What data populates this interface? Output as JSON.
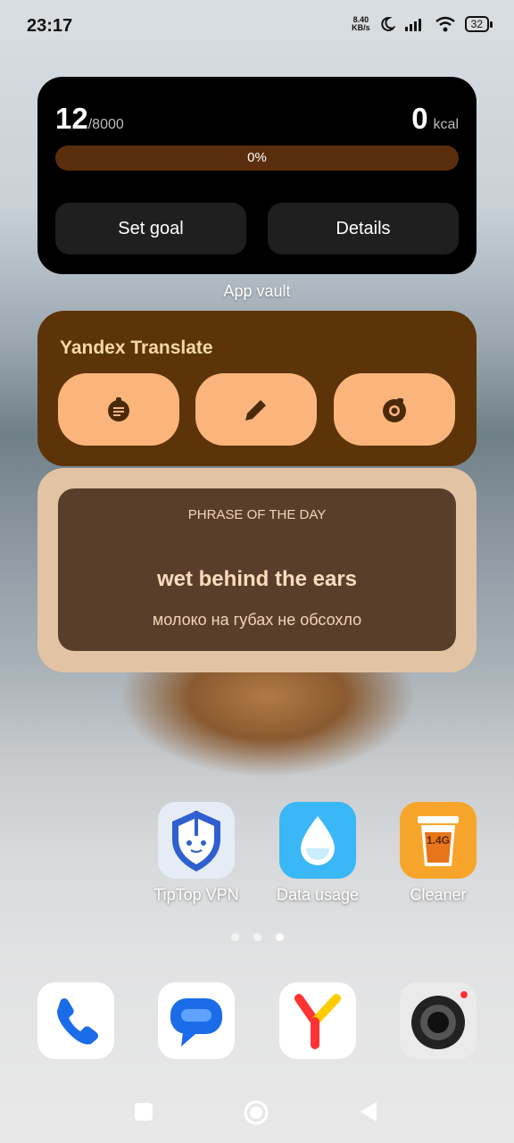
{
  "status_bar": {
    "time": "23:17",
    "net_speed_value": "8.40",
    "net_speed_unit": "KB/s",
    "battery": "32"
  },
  "step_widget": {
    "steps_value": "12",
    "steps_goal": "/8000",
    "kcal_value": "0",
    "kcal_unit": "kcal",
    "progress_label": "0%",
    "progress_fraction": 0,
    "set_goal_label": "Set goal",
    "details_label": "Details"
  },
  "app_vault_label": "App vault",
  "yandex_translate": {
    "title": "Yandex Translate",
    "buttons": [
      "dictionary-icon",
      "pencil-icon",
      "camera-icon"
    ]
  },
  "phrase": {
    "header": "PHRASE OF THE DAY",
    "english": "wet behind the ears",
    "russian": "молоко на губах не обсохло"
  },
  "apps": [
    {
      "label": "TipTop VPN",
      "icon": "shield-icon"
    },
    {
      "label": "Data usage",
      "icon": "water-drop-icon"
    },
    {
      "label": "Cleaner",
      "icon": "trash-bin-icon",
      "badge": "1.4G"
    }
  ],
  "page_indicator": {
    "count": 3,
    "active": 2
  },
  "dock": [
    "phone-icon",
    "messages-icon",
    "yandex-icon",
    "camera-app-icon"
  ],
  "colors": {
    "yt_bg": "#5c3408",
    "yt_button": "#fbb57c",
    "phrase_bg": "#593f2b",
    "phrase_frame": "#e2c4a5"
  }
}
